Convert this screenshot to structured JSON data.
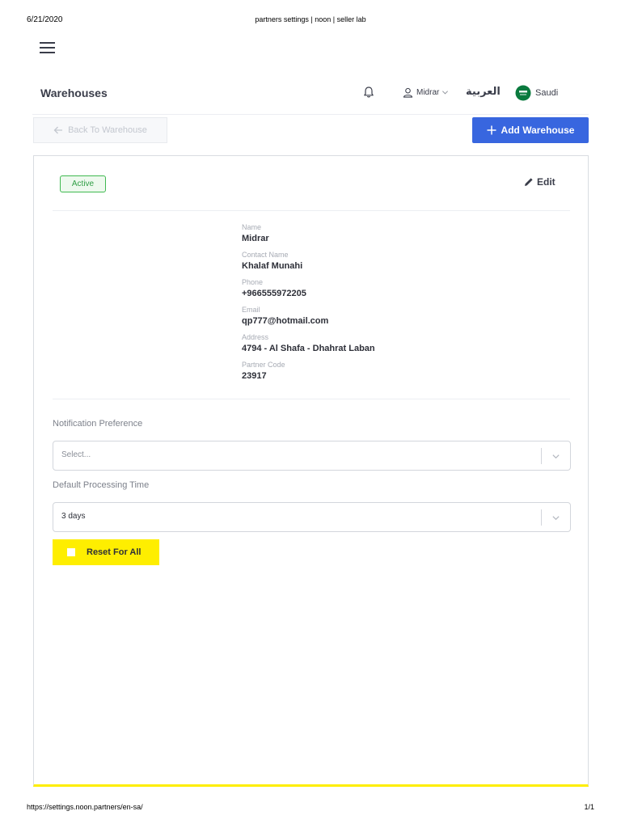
{
  "print": {
    "date": "6/21/2020",
    "title": "partners settings | noon | seller lab",
    "url": "https://settings.noon.partners/en-sa/",
    "page": "1/1"
  },
  "header": {
    "title": "Warehouses",
    "user_name": "Midrar",
    "language_link": "العربية",
    "country": "Saudi"
  },
  "toolbar": {
    "back_label": "Back To Warehouse",
    "add_label": "Add Warehouse"
  },
  "card": {
    "status": "Active",
    "edit_label": "Edit",
    "details": [
      {
        "label": "Name",
        "value": "Midrar"
      },
      {
        "label": "Contact Name",
        "value": "Khalaf Munahi"
      },
      {
        "label": "Phone",
        "value": "+966555972205"
      },
      {
        "label": "Email",
        "value": "qp777@hotmail.com"
      },
      {
        "label": "Address",
        "value": "4794 - Al Shafa - Dhahrat Laban"
      },
      {
        "label": "Partner Code",
        "value": "23917"
      }
    ],
    "notification_preference": {
      "label": "Notification Preference",
      "placeholder": "Select..."
    },
    "default_processing_time": {
      "label": "Default Processing Time",
      "value": "3 days"
    },
    "reset_label": "Reset For All"
  },
  "colors": {
    "primary": "#3866df",
    "accent_yellow": "#feee00",
    "status_green": "#3fb950"
  },
  "icons": [
    "menu-icon",
    "bell-icon",
    "user-icon",
    "chevron-down-icon",
    "saudi-flag-icon",
    "arrow-left-icon",
    "plus-icon",
    "pencil-icon"
  ]
}
